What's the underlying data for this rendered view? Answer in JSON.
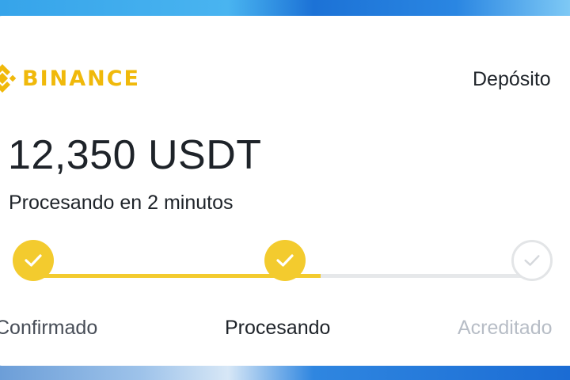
{
  "brand": {
    "name": "BINANCE",
    "color": "#F0B90B"
  },
  "header": {
    "title": "Depósito"
  },
  "deposit": {
    "amount": "12,350 USDT",
    "status": "Procesando en 2 minutos"
  },
  "steps": [
    {
      "label": "Confirmado",
      "state": "done",
      "icon": "check-icon"
    },
    {
      "label": "Procesando",
      "state": "active",
      "icon": "check-icon"
    },
    {
      "label": "Acreditado",
      "state": "pending",
      "icon": "check-icon"
    }
  ],
  "colors": {
    "accent": "#F3CB2E",
    "text": "#1e2329",
    "pending": "#b7bdc6"
  }
}
